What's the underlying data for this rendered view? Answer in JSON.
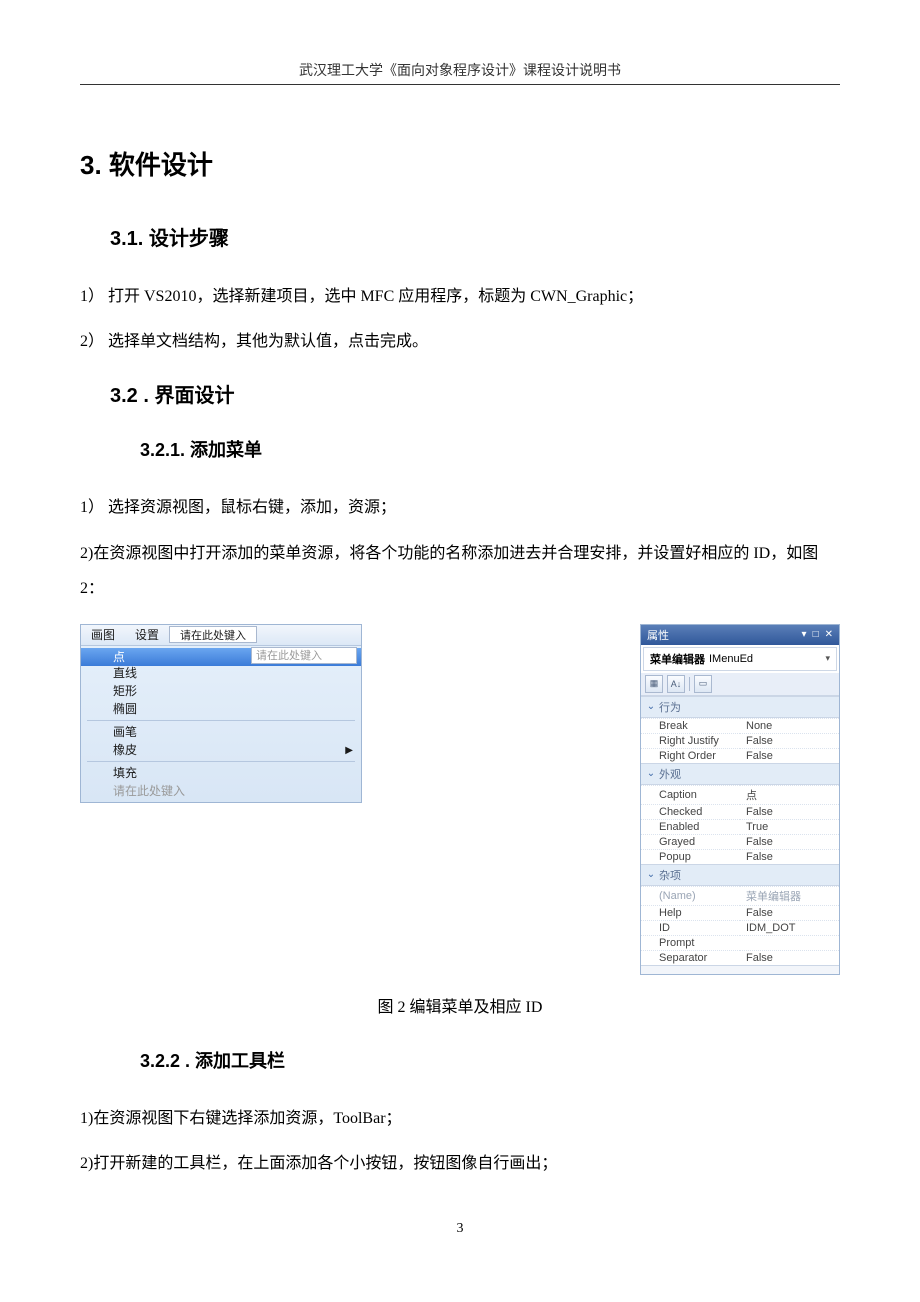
{
  "header": "武汉理工大学《面向对象程序设计》课程设计说明书",
  "h1": "3. 软件设计",
  "h2_1": "3.1. 设计步骤",
  "step1_1": "1）  打开 VS2010，选择新建项目，选中 MFC 应用程序，标题为 CWN_Graphic；",
  "step1_2": "2）  选择单文档结构，其他为默认值，点击完成。",
  "h2_2": "3.2 . 界面设计",
  "h3_1": "3.2.1. 添加菜单",
  "step2_1": "1）  选择资源视图，鼠标右键，添加，资源；",
  "step2_2": "2)在资源视图中打开添加的菜单资源，将各个功能的名称添加进去并合理安排，并设置好相应的 ID，如图 2：",
  "caption": "图 2  编辑菜单及相应 ID",
  "h3_2": "3.2.2 . 添加工具栏",
  "step3_1": "1)在资源视图下右键选择添加资源，ToolBar；",
  "step3_2": "2)打开新建的工具栏，在上面添加各个小按钮，按钮图像自行画出；",
  "pageNumber": "3",
  "menu": {
    "bar": [
      "画图",
      "设置"
    ],
    "placeholder": "请在此处键入",
    "items": [
      "点",
      "直线",
      "矩形",
      "椭圆",
      "画笔",
      "橡皮",
      "填充",
      "请在此处键入"
    ]
  },
  "props": {
    "title": "属性",
    "combo_label": "菜单编辑器",
    "combo_value": "IMenuEd",
    "catBehavior": "行为",
    "catAppearance": "外观",
    "catMisc": "杂项",
    "rows": {
      "break_k": "Break",
      "break_v": "None",
      "rj_k": "Right Justify",
      "rj_v": "False",
      "ro_k": "Right Order",
      "ro_v": "False",
      "caption_k": "Caption",
      "caption_v": "点",
      "checked_k": "Checked",
      "checked_v": "False",
      "enabled_k": "Enabled",
      "enabled_v": "True",
      "grayed_k": "Grayed",
      "grayed_v": "False",
      "popup_k": "Popup",
      "popup_v": "False",
      "name_k": "(Name)",
      "name_v": "菜单编辑器",
      "help_k": "Help",
      "help_v": "False",
      "id_k": "ID",
      "id_v": "IDM_DOT",
      "prompt_k": "Prompt",
      "prompt_v": "",
      "sep_k": "Separator",
      "sep_v": "False"
    }
  }
}
